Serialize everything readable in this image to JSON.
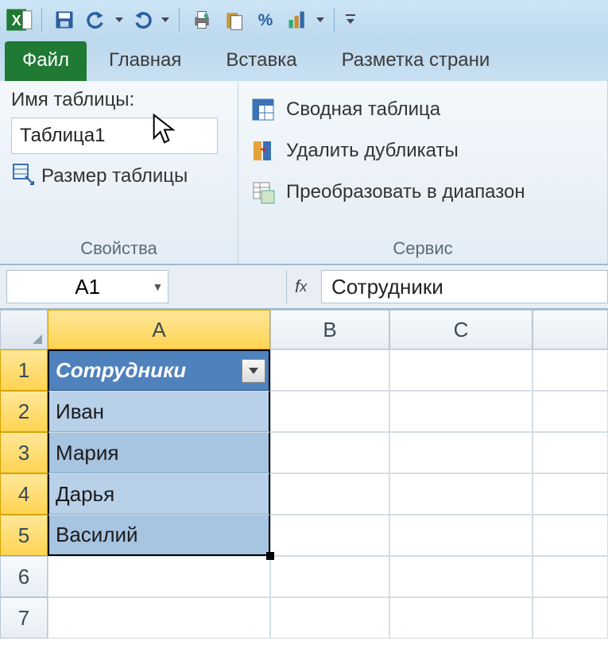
{
  "qat": {
    "icons": [
      "excel",
      "save",
      "undo",
      "redo",
      "print",
      "new",
      "percent",
      "help"
    ]
  },
  "tabs": {
    "file": "Файл",
    "home": "Главная",
    "insert": "Вставка",
    "pagelayout": "Разметка страни"
  },
  "ribbon": {
    "table_name_label": "Имя таблицы:",
    "table_name_value": "Таблица1",
    "resize_table": "Размер таблицы",
    "group_props": "Свойства",
    "pivot_table": "Сводная таблица",
    "remove_dupes": "Удалить дубликаты",
    "convert_range": "Преобразовать в диапазон",
    "group_service": "Сервис"
  },
  "namebox": "A1",
  "formula_value": "Сотрудники",
  "columns": [
    "A",
    "B",
    "C"
  ],
  "rows": [
    "1",
    "2",
    "3",
    "4",
    "5",
    "6",
    "7"
  ],
  "table": {
    "header": "Сотрудники",
    "data": [
      "Иван",
      "Мария",
      "Дарья",
      "Василий"
    ]
  }
}
